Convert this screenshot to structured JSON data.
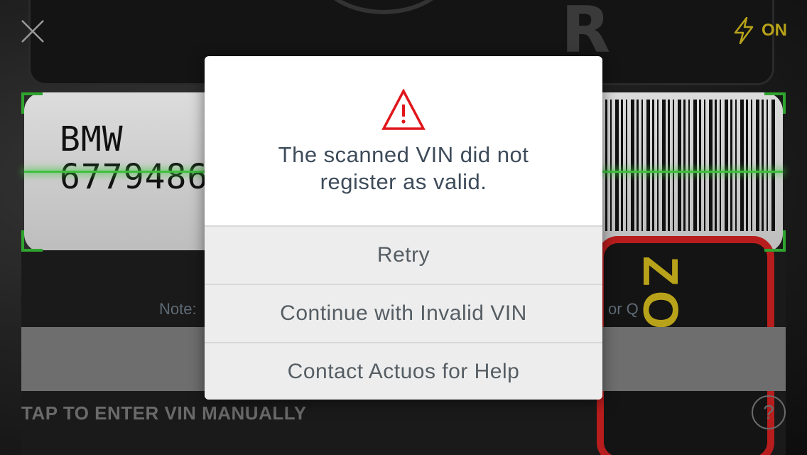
{
  "camera": {
    "sticker_brand": "BMW",
    "sticker_number": "6779486"
  },
  "toolbar": {
    "close_icon": "close-icon",
    "flash_icon": "lightning-icon",
    "flash_label": "ON",
    "flash_color": "#b8a21a"
  },
  "scanner": {
    "note_left": "Note:",
    "note_right": "or Q",
    "manual_entry_label": "TAP TO ENTER VIN MANUALLY",
    "help_label": "?"
  },
  "dialog": {
    "icon": "warning-icon",
    "icon_color": "#e0161c",
    "message": "The scanned VIN did not register as valid.",
    "buttons": [
      {
        "label": "Retry"
      },
      {
        "label": "Continue with Invalid VIN"
      },
      {
        "label": "Contact Actuos for Help"
      }
    ]
  }
}
